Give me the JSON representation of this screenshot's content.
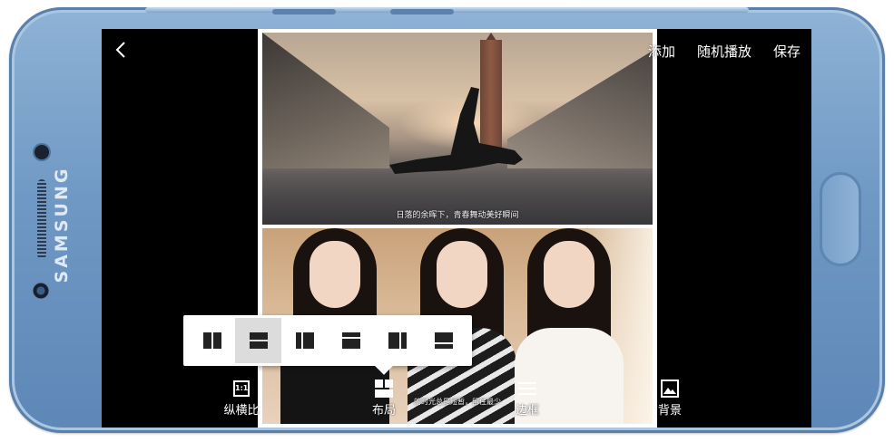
{
  "device": {
    "brand": "SAMSUNG"
  },
  "header": {
    "back_icon": "chevron-left-icon",
    "actions": [
      {
        "label": "添加"
      },
      {
        "label": "随机播放"
      },
      {
        "label": "保存"
      }
    ]
  },
  "collage": {
    "top_subtitle": "日落的余晖下，青春舞动美好瞬间",
    "bottom_subtitle": "的时光总是短暂，留住最少"
  },
  "layout_popup": {
    "options": [
      {
        "icon": "split-vertical-icon",
        "selected": false
      },
      {
        "icon": "split-horizontal-icon",
        "selected": true
      },
      {
        "icon": "split-vertical-wide-left-icon",
        "selected": false
      },
      {
        "icon": "split-horizontal-wide-bottom-icon",
        "selected": false
      },
      {
        "icon": "split-vertical-wide-right-icon",
        "selected": false
      },
      {
        "icon": "split-horizontal-wide-top-icon",
        "selected": false
      }
    ]
  },
  "toolbar": {
    "items": [
      {
        "label": "纵横比",
        "icon": "aspect-ratio-icon",
        "icon_text": "1:1"
      },
      {
        "label": "布局",
        "icon": "layout-icon"
      },
      {
        "label": "边框",
        "icon": "border-icon"
      },
      {
        "label": "背景",
        "icon": "background-image-icon"
      }
    ]
  },
  "colors": {
    "phone_body": "#6f98c4",
    "screen_bg": "#000000",
    "popup_bg": "#ffffff",
    "selected_option": "#dcdcdc",
    "text": "#ffffff"
  }
}
